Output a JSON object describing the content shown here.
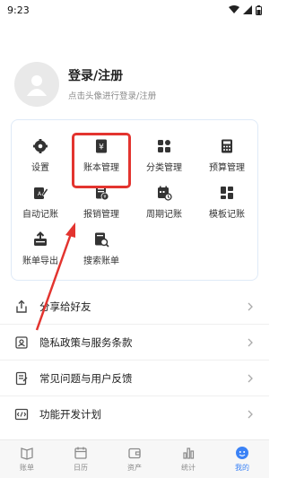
{
  "status": {
    "time": "9:23"
  },
  "profile": {
    "title": "登录/注册",
    "subtitle": "点击头像进行登录/注册"
  },
  "grid": [
    {
      "label": "设置",
      "icon": "gear-icon"
    },
    {
      "label": "账本管理",
      "icon": "ledger-icon"
    },
    {
      "label": "分类管理",
      "icon": "category-icon"
    },
    {
      "label": "预算管理",
      "icon": "calculator-icon"
    },
    {
      "label": "自动记账",
      "icon": "auto-bookkeeping-icon"
    },
    {
      "label": "报销管理",
      "icon": "reimbursement-icon"
    },
    {
      "label": "周期记账",
      "icon": "calendar-cycle-icon"
    },
    {
      "label": "模板记账",
      "icon": "template-icon"
    },
    {
      "label": "账单导出",
      "icon": "export-icon"
    },
    {
      "label": "搜索账单",
      "icon": "search-bill-icon"
    }
  ],
  "menu": [
    {
      "label": "分享给好友",
      "icon": "share-icon"
    },
    {
      "label": "隐私政策与服务条款",
      "icon": "privacy-icon"
    },
    {
      "label": "常见问题与用户反馈",
      "icon": "feedback-icon"
    },
    {
      "label": "功能开发计划",
      "icon": "roadmap-icon"
    }
  ],
  "nav": [
    {
      "label": "账单",
      "icon": "bill-book-icon"
    },
    {
      "label": "日历",
      "icon": "calendar-icon"
    },
    {
      "label": "资产",
      "icon": "wallet-icon"
    },
    {
      "label": "统计",
      "icon": "stats-icon"
    },
    {
      "label": "我的",
      "icon": "profile-icon",
      "active": true
    }
  ],
  "colors": {
    "accent": "#3b82f6",
    "highlight": "#e3342f",
    "icon": "#333333",
    "card_border": "#dfeaf7"
  }
}
